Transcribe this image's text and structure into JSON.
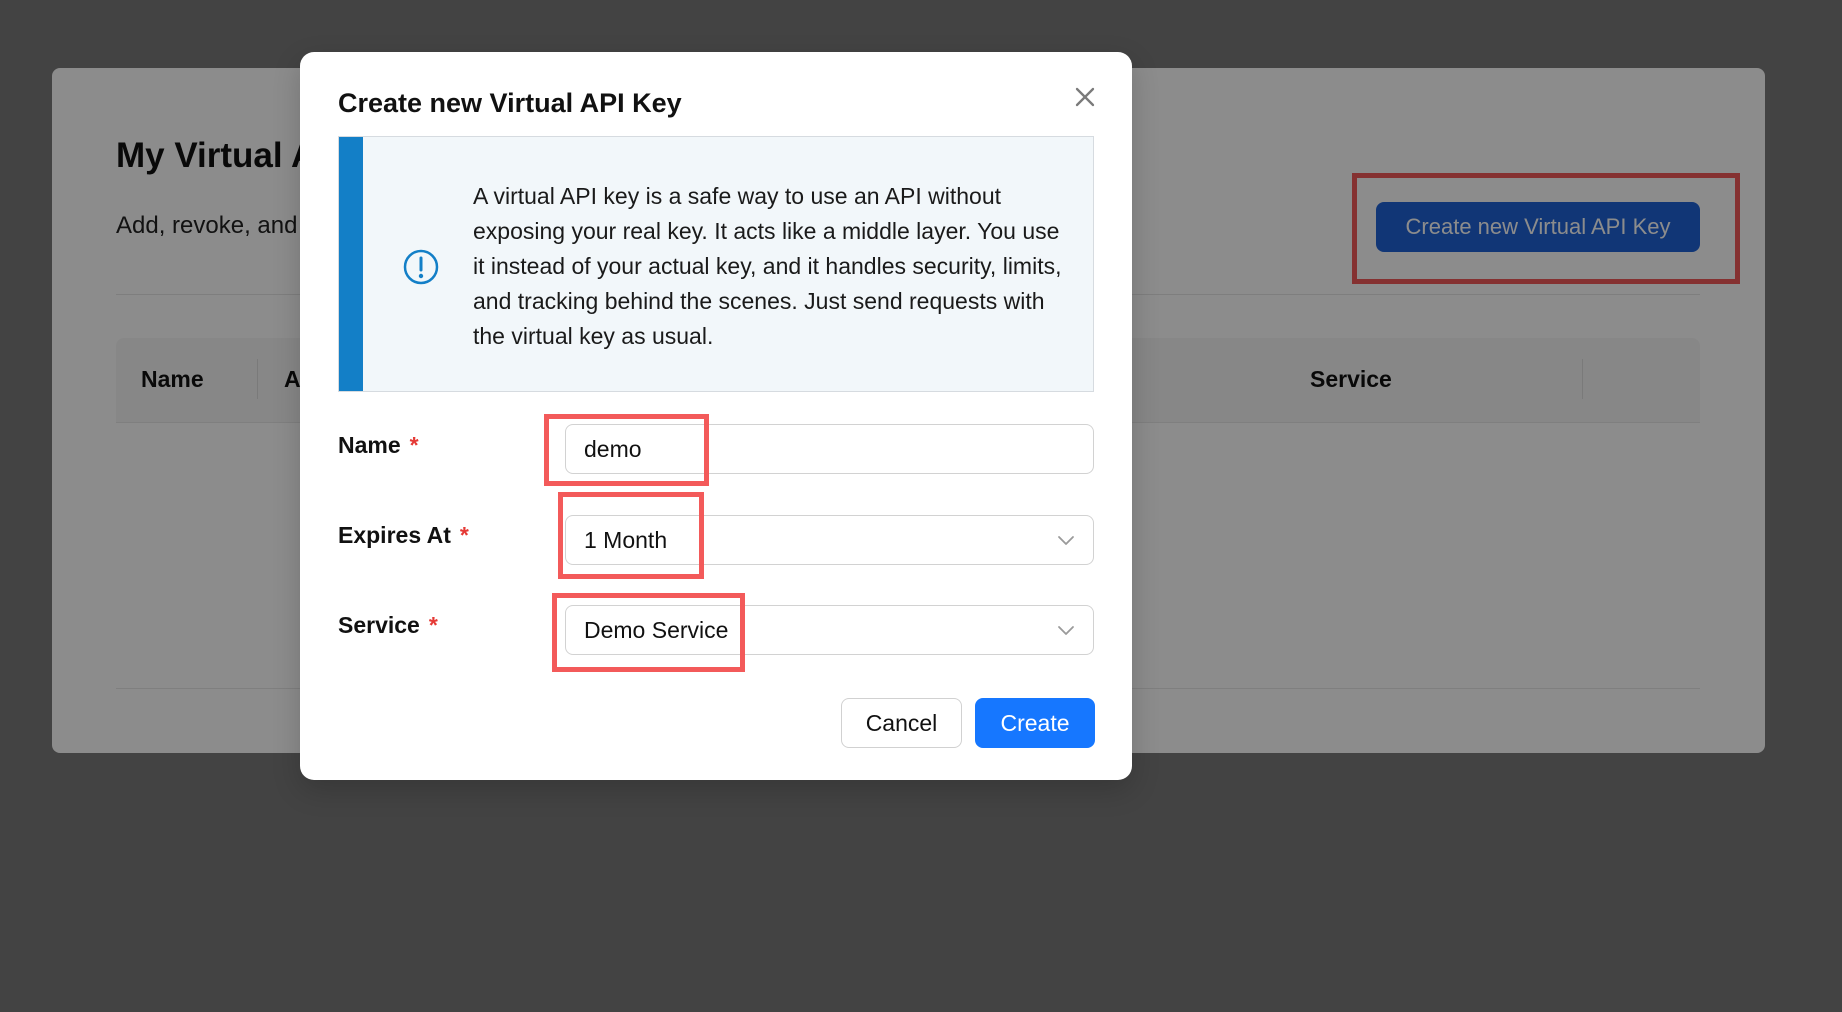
{
  "background": {
    "title": "My Virtual A",
    "subtitle": "Add, revoke, and",
    "create_button_label": "Create new Virtual API Key",
    "table": {
      "columns": [
        "Name",
        "A",
        "Service"
      ]
    }
  },
  "modal": {
    "title": "Create new Virtual API Key",
    "info_text": "A virtual API key is a safe way to use an API without exposing your real key. It acts like a middle layer. You use it instead of your actual key, and it handles security, limits, and tracking behind the scenes. Just send requests with the virtual key as usual.",
    "fields": {
      "name": {
        "label": "Name",
        "required_mark": "*",
        "value": "demo"
      },
      "expires_at": {
        "label": "Expires At",
        "required_mark": "*",
        "value": "1 Month"
      },
      "service": {
        "label": "Service",
        "required_mark": "*",
        "value": "Demo Service"
      }
    },
    "buttons": {
      "cancel": "Cancel",
      "create": "Create"
    }
  },
  "icons": {
    "close": "close-icon",
    "info": "info-icon",
    "chevron": "chevron-down-icon"
  },
  "colors": {
    "primary": "#1677ff",
    "background_button": "#1f63d8",
    "info_accent": "#137fc7",
    "highlight": "#f35a5a",
    "required": "#e53935"
  }
}
